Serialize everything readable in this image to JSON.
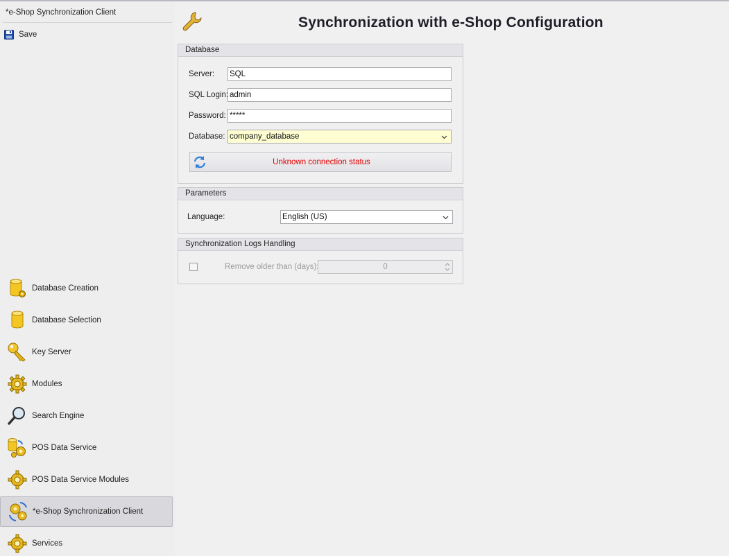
{
  "sidebar": {
    "title": "*e-Shop Synchronization Client",
    "save_label": "Save",
    "items": [
      {
        "label": "Database Creation",
        "icon": "database-gear-icon"
      },
      {
        "label": "Database Selection",
        "icon": "database-icon"
      },
      {
        "label": "Key Server",
        "icon": "key-icon"
      },
      {
        "label": "Modules",
        "icon": "gear-icon"
      },
      {
        "label": "Search Engine",
        "icon": "magnifier-icon"
      },
      {
        "label": "POS Data Service",
        "icon": "database-gears-icon"
      },
      {
        "label": "POS Data Service Modules",
        "icon": "gear-icon"
      },
      {
        "label": "*e-Shop Synchronization Client",
        "icon": "sync-gears-icon",
        "selected": true
      },
      {
        "label": "Services",
        "icon": "gear-icon"
      }
    ]
  },
  "main": {
    "title": "Synchronization with e-Shop Configuration",
    "database": {
      "header": "Database",
      "server_label": "Server:",
      "server_value": "SQL",
      "login_label": "SQL Login:",
      "login_value": "admin",
      "password_label": "Password:",
      "password_value": "*****",
      "database_label": "Database:",
      "database_value": "company_database",
      "status_text": "Unknown connection status"
    },
    "parameters": {
      "header": "Parameters",
      "language_label": "Language:",
      "language_value": "English (US)"
    },
    "logs": {
      "header": "Synchronization Logs Handling",
      "remove_label": "Remove older than (days):",
      "remove_value": "0",
      "checked": false
    }
  },
  "colors": {
    "status_text": "#e00000",
    "selected_item_bg": "#d9d9dd",
    "highlight_field": "#fefed2"
  }
}
